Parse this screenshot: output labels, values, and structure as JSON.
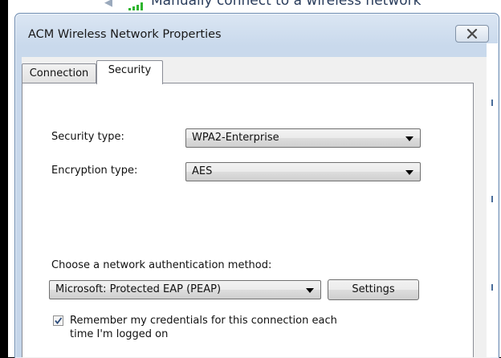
{
  "background_window": {
    "title": "Manually connect to a wireless network"
  },
  "dialog": {
    "title": "ACM Wireless Network Properties",
    "close_icon": "close-x-icon"
  },
  "tabs": [
    {
      "label": "Connection",
      "selected": false
    },
    {
      "label": "Security",
      "selected": true
    }
  ],
  "security": {
    "security_type_label": "Security type:",
    "security_type_value": "WPA2-Enterprise",
    "encryption_type_label": "Encryption type:",
    "encryption_type_value": "AES",
    "auth_method_label": "Choose a network authentication method:",
    "auth_method_value": "Microsoft: Protected EAP (PEAP)",
    "settings_button": "Settings",
    "remember_credentials_checked": true,
    "remember_credentials_line1": "Remember my credentials for this connection each",
    "remember_credentials_line2": "time I'm logged on"
  },
  "colors": {
    "title_bar": "#c9d9ec",
    "signal_green": "#2fb52f"
  }
}
